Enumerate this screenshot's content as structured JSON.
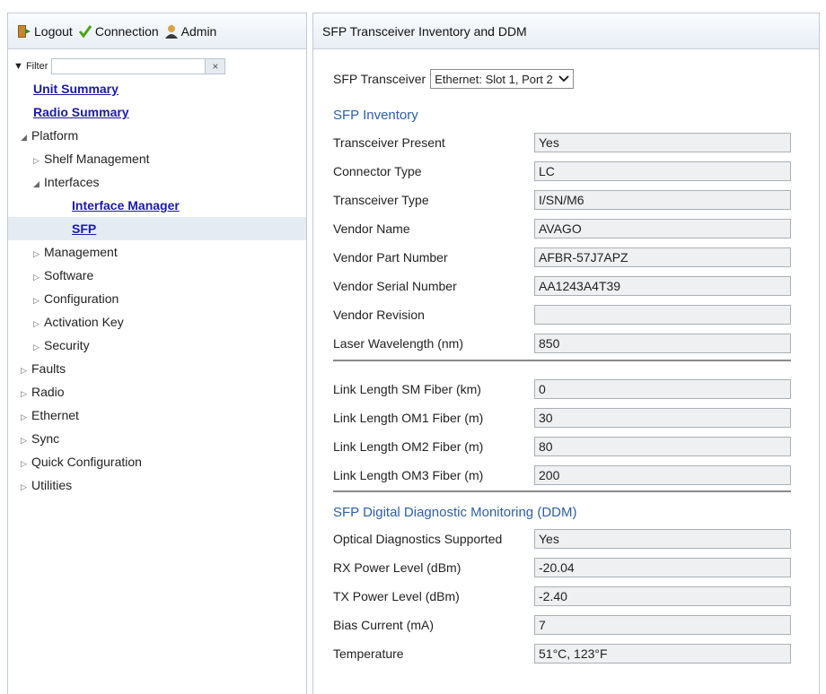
{
  "header": {
    "logout": "Logout",
    "connection": "Connection",
    "admin": "Admin"
  },
  "filter": {
    "label": "Filter",
    "placeholder": "",
    "clear": "×"
  },
  "tree": [
    {
      "label": "Unit Summary"
    },
    {
      "label": "Radio Summary"
    },
    {
      "label": "Platform"
    },
    {
      "label": "Shelf Management"
    },
    {
      "label": "Interfaces"
    },
    {
      "label": "Interface Manager"
    },
    {
      "label": "SFP"
    },
    {
      "label": "Management"
    },
    {
      "label": "Software"
    },
    {
      "label": "Configuration"
    },
    {
      "label": "Activation Key"
    },
    {
      "label": "Security"
    },
    {
      "label": "Faults"
    },
    {
      "label": "Radio"
    },
    {
      "label": "Ethernet"
    },
    {
      "label": "Sync"
    },
    {
      "label": "Quick Configuration"
    },
    {
      "label": "Utilities"
    }
  ],
  "page": {
    "title": "SFP Transceiver Inventory and DDM",
    "select_label": "SFP Transceiver",
    "select_value": "Ethernet: Slot 1, Port 2",
    "inventory_title": "SFP Inventory",
    "ddm_title": "SFP Digital Diagnostic Monitoring (DDM)"
  },
  "inventory": [
    {
      "label": "Transceiver Present",
      "value": "Yes"
    },
    {
      "label": "Connector Type",
      "value": "LC"
    },
    {
      "label": "Transceiver Type",
      "value": "I/SN/M6"
    },
    {
      "label": "Vendor Name",
      "value": "AVAGO"
    },
    {
      "label": "Vendor Part Number",
      "value": "AFBR-57J7APZ"
    },
    {
      "label": "Vendor Serial Number",
      "value": "AA1243A4T39"
    },
    {
      "label": "Vendor Revision",
      "value": ""
    },
    {
      "label": "Laser Wavelength (nm)",
      "value": "850"
    }
  ],
  "link": [
    {
      "label": "Link Length SM Fiber (km)",
      "value": "0"
    },
    {
      "label": "Link Length OM1 Fiber (m)",
      "value": "30"
    },
    {
      "label": "Link Length OM2 Fiber (m)",
      "value": "80"
    },
    {
      "label": "Link Length OM3 Fiber (m)",
      "value": "200"
    }
  ],
  "ddm": [
    {
      "label": "Optical Diagnostics Supported",
      "value": "Yes"
    },
    {
      "label": "RX Power Level (dBm)",
      "value": "-20.04"
    },
    {
      "label": "TX Power Level (dBm)",
      "value": "-2.40"
    },
    {
      "label": "Bias Current (mA)",
      "value": "7"
    },
    {
      "label": "Temperature",
      "value": "51°C, 123°F"
    }
  ]
}
